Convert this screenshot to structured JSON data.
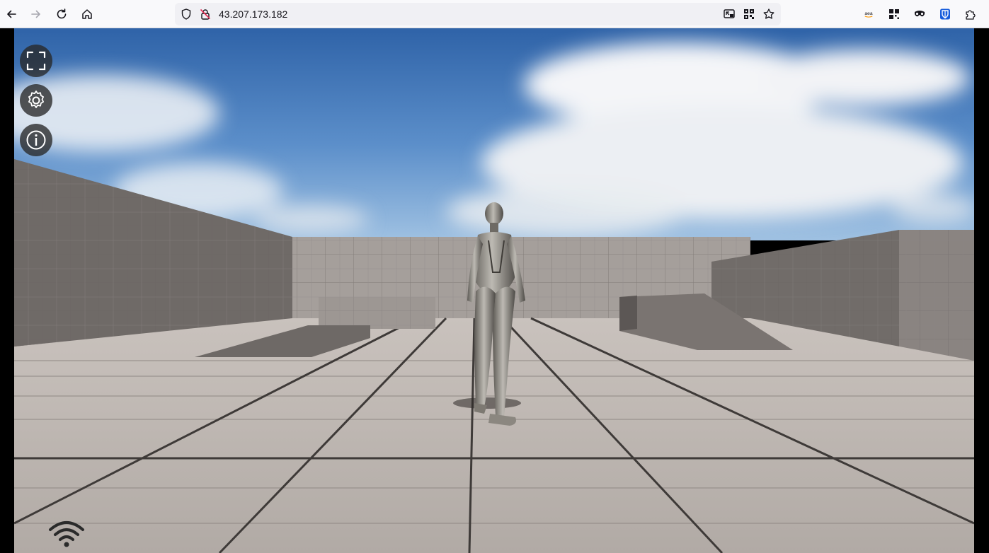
{
  "browser": {
    "url": "43.207.173.182",
    "extensions": [
      "aea",
      "qr-grid",
      "glasses",
      "bitwarden",
      "puzzle"
    ],
    "colors": {
      "toolbar_bg": "#f9f9fb",
      "urlbar_bg": "#f0f0f4",
      "bitwarden": "#175ddc"
    }
  },
  "stream": {
    "controls": [
      "fullscreen-icon",
      "settings-gear-icon",
      "info-icon"
    ],
    "connection_indicator": "wifi-icon"
  }
}
